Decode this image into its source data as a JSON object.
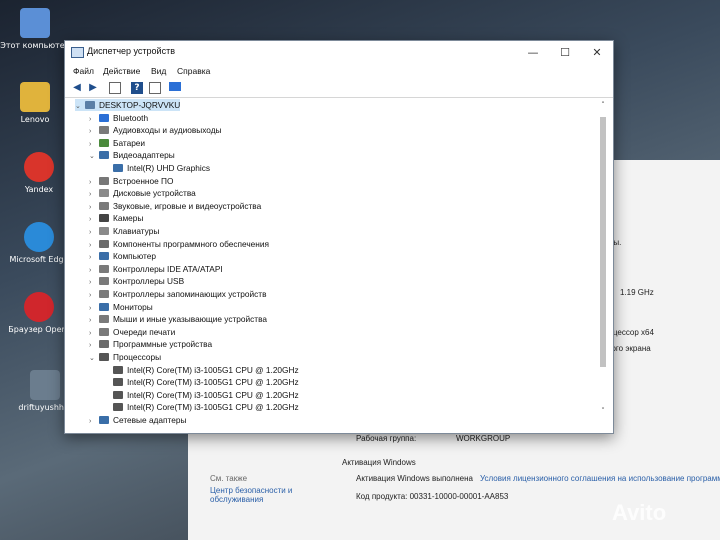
{
  "desktop": {
    "icons": [
      {
        "label": "Этот компьютер",
        "color": "#5b8fd6"
      },
      {
        "label": "Lenovo",
        "color": "#e0b33c"
      },
      {
        "label": "Yandex",
        "color": "#d9342b"
      },
      {
        "label": "Microsoft Edge",
        "color": "#2a8ad8"
      },
      {
        "label": "Браузер Opera",
        "color": "#d0262c"
      },
      {
        "label": "driftuyushh...",
        "color": "#6b7d8e"
      }
    ]
  },
  "system_window": {
    "fragments": {
      "line1": "щены.",
      "line2": "lz",
      "speed": "1.19 GHz",
      "arch": "роцессор x64",
      "screen": "этого экрана",
      "workgroup_label": "Рабочая группа:",
      "workgroup_value": "WORKGROUP",
      "activation_header": "Активация Windows",
      "activation_status": "Активация Windows выполнена",
      "license_link": "Условия лицензионного соглашения на использование программ",
      "product_code": "Код продукта: 00331-10000-00001-AA853",
      "see_also": "См. также",
      "security_center": "Центр безопасности и обслуживания"
    }
  },
  "window": {
    "title": "Диспетчер устройств",
    "controls": {
      "minimize": "—",
      "maximize": "☐",
      "close": "✕"
    },
    "menu": [
      "Файл",
      "Действие",
      "Вид",
      "Справка"
    ],
    "toolbar": [
      "back-icon",
      "forward-icon",
      "properties-icon",
      "help-icon",
      "view-icon",
      "monitor-icon"
    ]
  },
  "tree": [
    {
      "label": "DESKTOP-JQRVVKU",
      "expander": "⌄",
      "icon": "#5b7fa6",
      "sel": true
    },
    {
      "label": "Bluetooth",
      "expander": "›",
      "icon": "#2a6fd6"
    },
    {
      "label": "Аудиовходы и аудиовыходы",
      "expander": "›",
      "icon": "#7a7a7a"
    },
    {
      "label": "Батареи",
      "expander": "›",
      "icon": "#4b8a3c"
    },
    {
      "label": "Видеоадаптеры",
      "expander": "⌄",
      "icon": "#3a6ea8"
    },
    {
      "label": "Intel(R) UHD Graphics",
      "expander": "",
      "icon": "#3a6ea8"
    },
    {
      "label": "Встроенное ПО",
      "expander": "›",
      "icon": "#777777"
    },
    {
      "label": "Дисковые устройства",
      "expander": "›",
      "icon": "#8a8a8a"
    },
    {
      "label": "Звуковые, игровые и видеоустройства",
      "expander": "›",
      "icon": "#7a7a7a"
    },
    {
      "label": "Камеры",
      "expander": "›",
      "icon": "#444444"
    },
    {
      "label": "Клавиатуры",
      "expander": "›",
      "icon": "#8a8a8a"
    },
    {
      "label": "Компоненты программного обеспечения",
      "expander": "›",
      "icon": "#6a6a6a"
    },
    {
      "label": "Компьютер",
      "expander": "›",
      "icon": "#3a6ea8"
    },
    {
      "label": "Контроллеры IDE ATA/ATAPI",
      "expander": "›",
      "icon": "#7a7a7a"
    },
    {
      "label": "Контроллеры USB",
      "expander": "›",
      "icon": "#7a7a7a"
    },
    {
      "label": "Контроллеры запоминающих устройств",
      "expander": "›",
      "icon": "#7a7a7a"
    },
    {
      "label": "Мониторы",
      "expander": "›",
      "icon": "#3a6ea8"
    },
    {
      "label": "Мыши и иные указывающие устройства",
      "expander": "›",
      "icon": "#7a7a7a"
    },
    {
      "label": "Очереди печати",
      "expander": "›",
      "icon": "#7a7a7a"
    },
    {
      "label": "Программные устройства",
      "expander": "›",
      "icon": "#6a6a6a"
    },
    {
      "label": "Процессоры",
      "expander": "⌄",
      "icon": "#555555"
    },
    {
      "label": "Intel(R) Core(TM) i3-1005G1 CPU @ 1.20GHz",
      "expander": "",
      "icon": "#555555"
    },
    {
      "label": "Intel(R) Core(TM) i3-1005G1 CPU @ 1.20GHz",
      "expander": "",
      "icon": "#555555"
    },
    {
      "label": "Intel(R) Core(TM) i3-1005G1 CPU @ 1.20GHz",
      "expander": "",
      "icon": "#555555"
    },
    {
      "label": "Intel(R) Core(TM) i3-1005G1 CPU @ 1.20GHz",
      "expander": "",
      "icon": "#555555"
    },
    {
      "label": "Сетевые адаптеры",
      "expander": "›",
      "icon": "#3a6ea8"
    }
  ],
  "scrollbar": {
    "up": "˄",
    "down": "˅"
  },
  "watermark": "Avito"
}
